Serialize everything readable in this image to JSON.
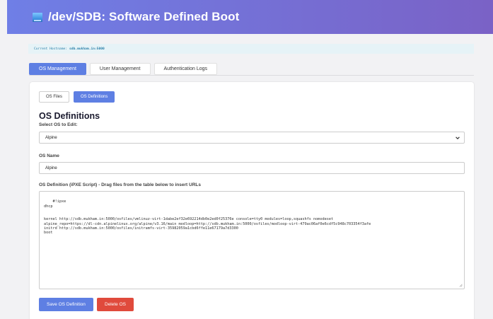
{
  "header": {
    "title": "/dev/SDB: Software Defined Boot",
    "icon": "computer-icon"
  },
  "hostname": {
    "label": "Current Hostname:",
    "value": "sdb.mukham.in:5000"
  },
  "tabs": [
    {
      "label": "OS Management",
      "active": true
    },
    {
      "label": "User Management",
      "active": false
    },
    {
      "label": "Authentication Logs",
      "active": false
    }
  ],
  "subtabs": [
    {
      "label": "OS Files",
      "active": false
    },
    {
      "label": "OS Definitions",
      "active": true
    }
  ],
  "section": {
    "title": "OS Definitions",
    "select_label": "Select OS to Edit:",
    "select_value": "Alpine",
    "name_label": "OS Name",
    "name_value": "Alpine",
    "script_label": "OS Definition (iPXE Script) - Drag files from the table below to insert URLs",
    "script_value": "#!ipxe\ndhcp\n\n\nkernel http://sdb.mukham.in:5000/osfiles/vmlinuz-virt-1dabe2ef32e692214db0e2ed0f25376e console=tty0 modules=loop,squashfs nomodeset\nalpine_repo=https://dl-cdn.alpinelinux.org/alpine/v3.16/main modloop=http://sdb.mukham.in:5000/osfiles/modloop-virt-479ac06af0e6cdf5c948c703354f3afe\ninitrd http://sdb.mukham.in:5000/osfiles/initramfs-virt-35982059a1cbd6ffe11e67179a7d3300\nboot"
  },
  "buttons": {
    "save": "Save OS Definition",
    "delete": "Delete OS"
  },
  "colors": {
    "primary": "#5e7fe3",
    "danger": "#e04a3c",
    "header_start": "#6f7fe6",
    "header_end": "#7a62c6"
  }
}
